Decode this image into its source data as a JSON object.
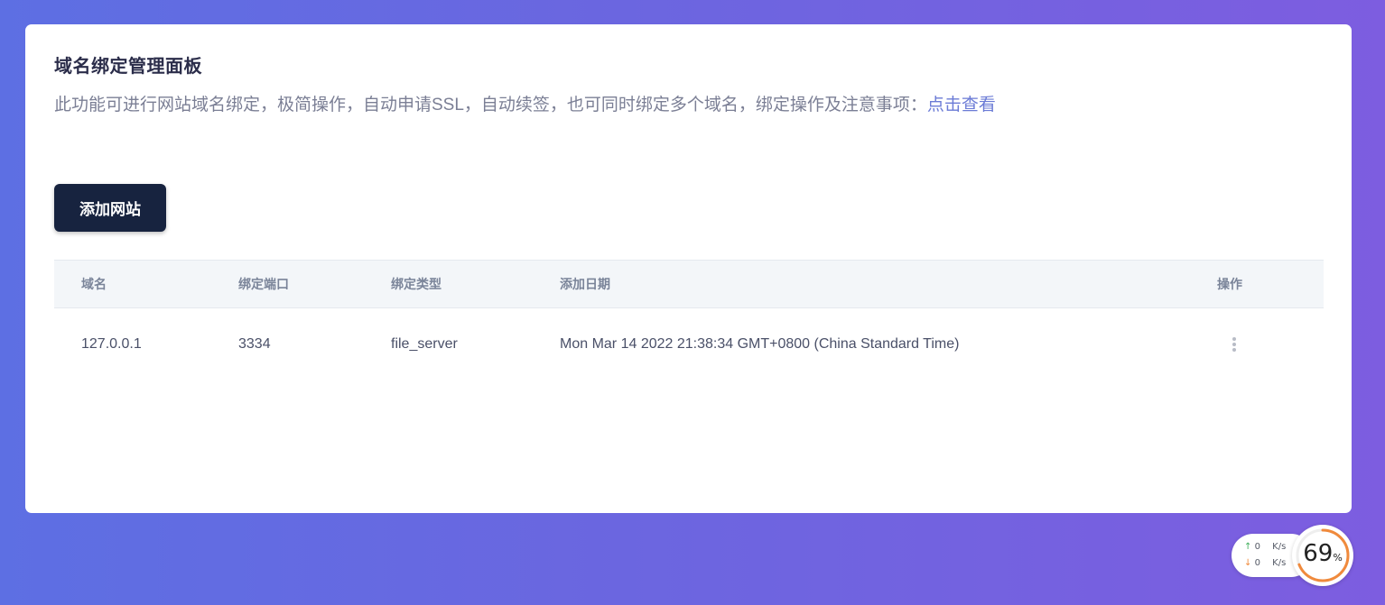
{
  "panel": {
    "title": "域名绑定管理面板",
    "description": "此功能可进行网站域名绑定，极简操作，自动申请SSL，自动续签，也可同时绑定多个域名，绑定操作及注意事项：",
    "link_label": "点击查看",
    "add_button_label": "添加网站"
  },
  "table": {
    "headers": {
      "domain": "域名",
      "port": "绑定端口",
      "type": "绑定类型",
      "date": "添加日期",
      "ops": "操作"
    },
    "rows": [
      {
        "domain": "127.0.0.1",
        "port": "3334",
        "type": "file_server",
        "date": "Mon Mar 14 2022 21:38:34 GMT+0800 (China Standard Time)",
        "ops_icon": "more-vertical-icon"
      }
    ]
  },
  "network": {
    "upload_value": "0",
    "upload_unit": "K/s",
    "download_value": "0",
    "download_unit": "K/s",
    "up_arrow": "↑",
    "down_arrow": "↓"
  },
  "cpu": {
    "value": "69",
    "unit": "%",
    "percent": 69,
    "ring_color": "#f08a3c"
  },
  "colors": {
    "primary_button": "#17233f",
    "link": "#6b7bd6",
    "upload": "#3fae5a",
    "download": "#f08a3c"
  }
}
